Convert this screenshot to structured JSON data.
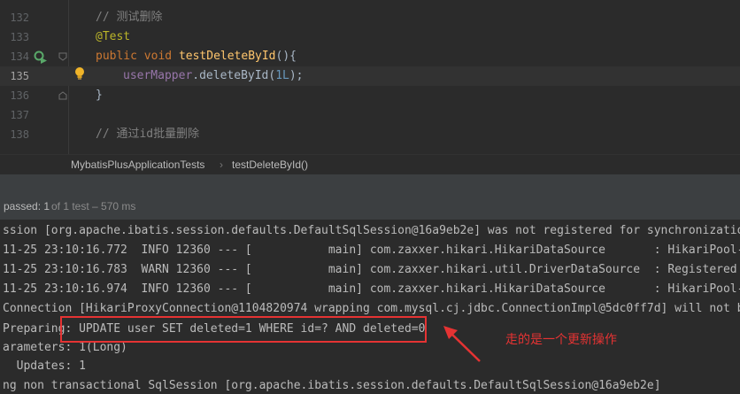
{
  "editor": {
    "line_numbers": [
      "132",
      "133",
      "134",
      "135",
      "136",
      "137",
      "138"
    ],
    "comment_1": "// 测试删除",
    "annotation": "@Test",
    "kw_public": "public",
    "kw_void": "void",
    "method_name": "testDeleteById",
    "method_suffix": "(){",
    "mapper_field": "userMapper",
    "call_text": ".deleteById(",
    "call_arg": "1L",
    "call_end": ");",
    "close_brace": "}",
    "comment_2": "// 通过id批量删除"
  },
  "breadcrumb": {
    "items": [
      "MybatisPlusApplicationTests",
      "testDeleteById()"
    ],
    "separator": "›"
  },
  "test_status": {
    "passed_label": "passed: 1",
    "detail": "of 1 test – 570 ms"
  },
  "console": {
    "lines": [
      "ssion [org.apache.ibatis.session.defaults.DefaultSqlSession@16a9eb2e] was not registered for synchronization b",
      "11-25 23:10:16.772  INFO 12360 --- [           main] com.zaxxer.hikari.HikariDataSource       : HikariPool-1 -",
      "11-25 23:10:16.783  WARN 12360 --- [           main] com.zaxxer.hikari.util.DriverDataSource  : Registered dri",
      "11-25 23:10:16.974  INFO 12360 --- [           main] com.zaxxer.hikari.HikariDataSource       : HikariPool-1 -",
      "Connection [HikariProxyConnection@1104820974 wrapping com.mysql.cj.jdbc.ConnectionImpl@5dc0ff7d] will not be m",
      "Preparing: UPDATE user SET deleted=1 WHERE id=? AND deleted=0",
      "arameters: 1(Long)",
      "  Updates: 1",
      "ng non transactional SqlSession [org.apache.ibatis.session.defaults.DefaultSqlSession@16a9eb2e]"
    ]
  },
  "annotation_note": "走的是一个更新操作",
  "colors": {
    "editor_bg": "#2b2b2b",
    "panel_bg": "#3c3f41",
    "annotation_red": "#e53333",
    "keyword": "#cc7832",
    "method": "#ffc66d",
    "field": "#9876aa",
    "number": "#6897bb",
    "comment": "#808080",
    "annotation_yellow": "#bbb529"
  },
  "icons": [
    "run-test-icon",
    "fold-marker-icon",
    "intention-bulb-icon",
    "red-arrow-icon"
  ]
}
